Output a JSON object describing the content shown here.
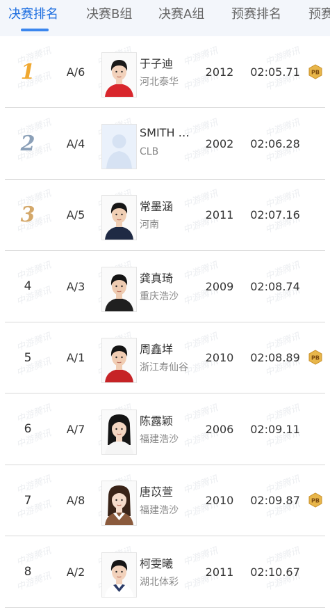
{
  "tabs": [
    "决赛排名",
    "决赛B组",
    "决赛A组",
    "预赛排名",
    "预赛"
  ],
  "watermark": "中游腾讯",
  "rows": [
    {
      "rank": "1",
      "medal": "gold",
      "lane": "A/6",
      "name": "于子迪",
      "team": "河北泰华",
      "year": "2012",
      "time": "02:05.71",
      "pb": true,
      "avatar": "red"
    },
    {
      "rank": "2",
      "medal": "silver",
      "lane": "A/4",
      "name": "SMITH …",
      "team": "CLB",
      "year": "2002",
      "time": "02:06.28",
      "pb": false,
      "avatar": "placeholder"
    },
    {
      "rank": "3",
      "medal": "bronze",
      "lane": "A/5",
      "name": "常墨涵",
      "team": "河南",
      "year": "2011",
      "time": "02:07.16",
      "pb": false,
      "avatar": "navy"
    },
    {
      "rank": "4",
      "medal": "",
      "lane": "A/3",
      "name": "龚真琦",
      "team": "重庆浩沙",
      "year": "2009",
      "time": "02:08.74",
      "pb": false,
      "avatar": "black"
    },
    {
      "rank": "5",
      "medal": "",
      "lane": "A/1",
      "name": "周鑫垟",
      "team": "浙江寿仙谷",
      "year": "2010",
      "time": "02:08.89",
      "pb": true,
      "avatar": "redblack"
    },
    {
      "rank": "6",
      "medal": "",
      "lane": "A/7",
      "name": "陈露颖",
      "team": "福建浩沙",
      "year": "2006",
      "time": "02:09.11",
      "pb": false,
      "avatar": "white"
    },
    {
      "rank": "7",
      "medal": "",
      "lane": "A/8",
      "name": "唐苡萱",
      "team": "福建浩沙",
      "year": "2010",
      "time": "02:09.87",
      "pb": true,
      "avatar": "brown"
    },
    {
      "rank": "8",
      "medal": "",
      "lane": "A/2",
      "name": "柯雯曦",
      "team": "湖北体彩",
      "year": "2011",
      "time": "02:10.67",
      "pb": false,
      "avatar": "sailor"
    }
  ],
  "pb_label": "PB"
}
